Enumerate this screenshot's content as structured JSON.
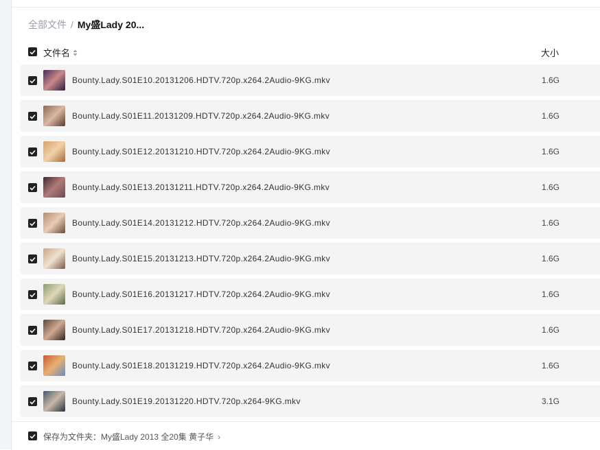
{
  "breadcrumb": {
    "root": "全部文件",
    "separator": "/",
    "current": "My盛Lady 20..."
  },
  "header": {
    "name_label": "文件名",
    "size_label": "大小"
  },
  "files": [
    {
      "name": "Bounty.Lady.S01E10.20131206.HDTV.720p.x264.2Audio-9KG.mkv",
      "size": "1.6G",
      "thumb_colors": [
        "#4a2a5e",
        "#c98a8a",
        "#2b1b3d"
      ]
    },
    {
      "name": "Bounty.Lady.S01E11.20131209.HDTV.720p.x264.2Audio-9KG.mkv",
      "size": "1.6G",
      "thumb_colors": [
        "#8a6a58",
        "#d9b7a0",
        "#5a3b34"
      ]
    },
    {
      "name": "Bounty.Lady.S01E12.20131210.HDTV.720p.x264.2Audio-9KG.mkv",
      "size": "1.6G",
      "thumb_colors": [
        "#d8a06a",
        "#f0d2a8",
        "#a86a3a"
      ]
    },
    {
      "name": "Bounty.Lady.S01E13.20131211.HDTV.720p.x264.2Audio-9KG.mkv",
      "size": "1.6G",
      "thumb_colors": [
        "#3d2a2e",
        "#b07a78",
        "#6a4a52"
      ]
    },
    {
      "name": "Bounty.Lady.S01E14.20131212.HDTV.720p.x264.2Audio-9KG.mkv",
      "size": "1.6G",
      "thumb_colors": [
        "#b58a70",
        "#e9cdb6",
        "#6b4a3a"
      ]
    },
    {
      "name": "Bounty.Lady.S01E15.20131213.HDTV.720p.x264.2Audio-9KG.mkv",
      "size": "1.6G",
      "thumb_colors": [
        "#c9a888",
        "#efe1cf",
        "#7a5a46"
      ]
    },
    {
      "name": "Bounty.Lady.S01E16.20131217.HDTV.720p.x264.2Audio-9KG.mkv",
      "size": "1.6G",
      "thumb_colors": [
        "#8aa070",
        "#e0d6b8",
        "#5a6a48"
      ]
    },
    {
      "name": "Bounty.Lady.S01E17.20131218.HDTV.720p.x264.2Audio-9KG.mkv",
      "size": "1.6G",
      "thumb_colors": [
        "#5a4a3e",
        "#d0a890",
        "#2e2620"
      ]
    },
    {
      "name": "Bounty.Lady.S01E18.20131219.HDTV.720p.x264.2Audio-9KG.mkv",
      "size": "1.6G",
      "thumb_colors": [
        "#c85a3a",
        "#e8b070",
        "#6a8ac0"
      ]
    },
    {
      "name": "Bounty.Lady.S01E19.20131220.HDTV.720p.x264-9KG.mkv",
      "size": "3.1G",
      "thumb_colors": [
        "#4a5a6a",
        "#c8b8a8",
        "#2a3038"
      ]
    }
  ],
  "footer": {
    "save_label": "保存为文件夹：My盛Lady 2013 全20集 黄子华",
    "chevron": "›"
  }
}
